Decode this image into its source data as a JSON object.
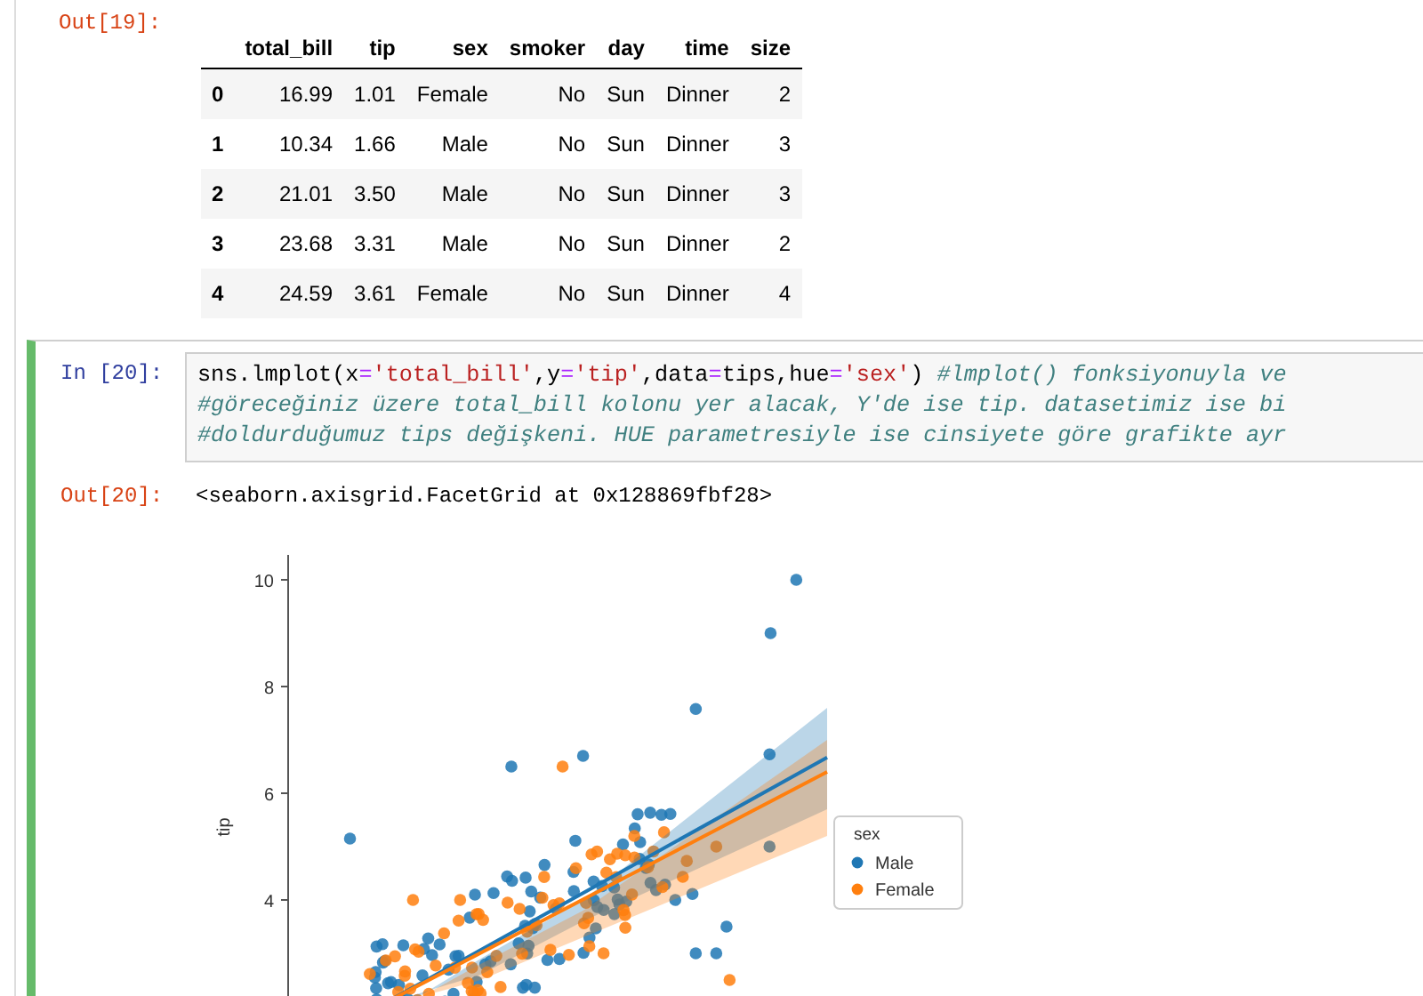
{
  "output_19": {
    "prompt": "Out[19]:",
    "table": {
      "columns": [
        "",
        "total_bill",
        "tip",
        "sex",
        "smoker",
        "day",
        "time",
        "size"
      ],
      "rows": [
        [
          "0",
          "16.99",
          "1.01",
          "Female",
          "No",
          "Sun",
          "Dinner",
          "2"
        ],
        [
          "1",
          "10.34",
          "1.66",
          "Male",
          "No",
          "Sun",
          "Dinner",
          "3"
        ],
        [
          "2",
          "21.01",
          "3.50",
          "Male",
          "No",
          "Sun",
          "Dinner",
          "3"
        ],
        [
          "3",
          "23.68",
          "3.31",
          "Male",
          "No",
          "Sun",
          "Dinner",
          "2"
        ],
        [
          "4",
          "24.59",
          "3.61",
          "Female",
          "No",
          "Sun",
          "Dinner",
          "4"
        ]
      ]
    }
  },
  "cell_20": {
    "selected": true,
    "prompt": "In [20]:",
    "code_lines": [
      [
        {
          "kind": "plain",
          "text": "sns.lmplot(x"
        },
        {
          "kind": "op",
          "text": "="
        },
        {
          "kind": "string",
          "text": "'total_bill'"
        },
        {
          "kind": "plain",
          "text": ",y"
        },
        {
          "kind": "op",
          "text": "="
        },
        {
          "kind": "string",
          "text": "'tip'"
        },
        {
          "kind": "plain",
          "text": ",data"
        },
        {
          "kind": "op",
          "text": "="
        },
        {
          "kind": "plain",
          "text": "tips,hue"
        },
        {
          "kind": "op",
          "text": "="
        },
        {
          "kind": "string",
          "text": "'sex'"
        },
        {
          "kind": "plain",
          "text": ") "
        },
        {
          "kind": "comment",
          "text": "#lmplot() fonksiyonuyla ve"
        }
      ],
      [
        {
          "kind": "comment",
          "text": "#göreceğiniz üzere total_bill kolonu yer alacak, Y'de ise tip. datasetimiz ise bi"
        }
      ],
      [
        {
          "kind": "comment",
          "text": "#doldurduğumuz tips değişkeni. HUE parametresiyle ise cinsiyete göre grafikte ayr"
        }
      ]
    ],
    "output_prompt": "Out[20]:",
    "output_text": "<seaborn.axisgrid.FacetGrid at 0x128869fbf28>",
    "plot": {
      "ylabel": "tip",
      "yticks": [
        "10",
        "8",
        "6",
        "4"
      ],
      "legend": {
        "title": "sex",
        "items": [
          {
            "label": "Male",
            "color": "#1f77b4"
          },
          {
            "label": "Female",
            "color": "#ff7f0e"
          }
        ]
      }
    }
  }
}
